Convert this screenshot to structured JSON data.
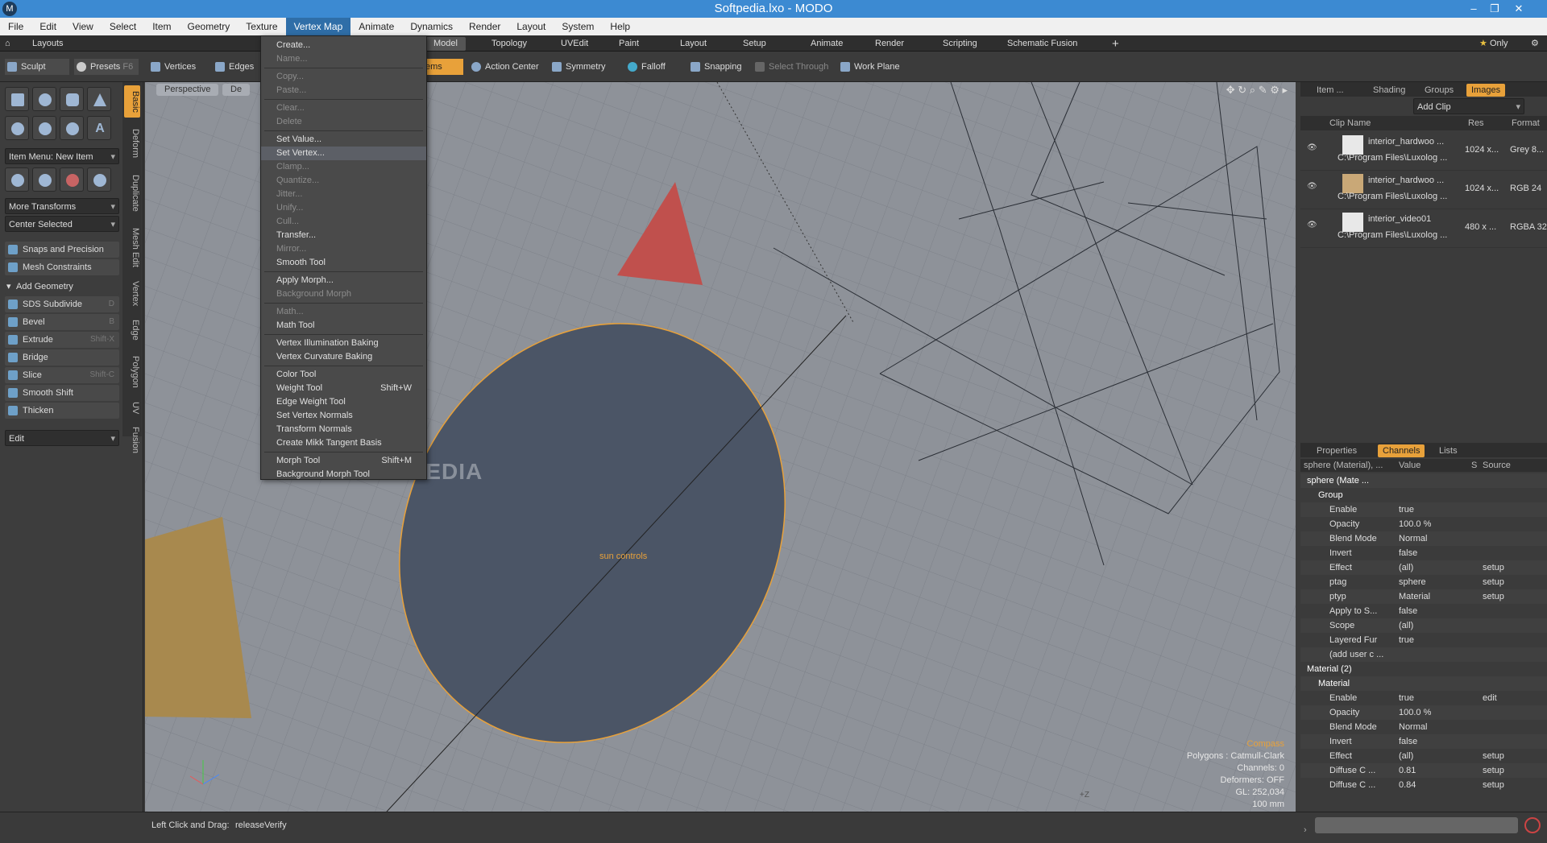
{
  "window": {
    "title": "Softpedia.lxo - MODO",
    "logo": "M"
  },
  "menubar": [
    "File",
    "Edit",
    "View",
    "Select",
    "Item",
    "Geometry",
    "Texture",
    "Vertex Map",
    "Animate",
    "Dynamics",
    "Render",
    "Layout",
    "System",
    "Help"
  ],
  "layouts_label": "Layouts",
  "tabs": [
    "Model",
    "Topology",
    "UVEdit",
    "Paint",
    "Layout",
    "Setup",
    "Animate",
    "Render",
    "Scripting",
    "Schematic Fusion"
  ],
  "only_label": "Only",
  "toolbar": {
    "sculpt": "Sculpt",
    "presets": "Presets",
    "presets_key": "F6",
    "vertices": "Vertices",
    "edges": "Edges",
    "items": "ems",
    "action_center": "Action Center",
    "symmetry": "Symmetry",
    "falloff": "Falloff",
    "snapping": "Snapping",
    "select_through": "Select Through",
    "work_plane": "Work Plane"
  },
  "left": {
    "item_menu": "Item Menu: New Item",
    "more_transforms": "More Transforms",
    "center_selected": "Center Selected",
    "snaps": "Snaps and Precision",
    "mesh_constraints": "Mesh Constraints",
    "add_geometry": "Add Geometry",
    "tools": [
      {
        "label": "SDS Subdivide",
        "key": "D"
      },
      {
        "label": "Bevel",
        "key": "B"
      },
      {
        "label": "Extrude",
        "key": "Shift-X"
      },
      {
        "label": "Bridge",
        "key": ""
      },
      {
        "label": "Slice",
        "key": "Shift-C"
      },
      {
        "label": "Smooth Shift",
        "key": ""
      },
      {
        "label": "Thicken",
        "key": ""
      }
    ],
    "edit_dropdown": "Edit",
    "vtabs": [
      "Basic",
      "Deform",
      "Duplicate",
      "Mesh Edit",
      "Vertex",
      "Edge",
      "Polygon",
      "UV",
      "Fusion"
    ]
  },
  "viewport": {
    "perspective": "Perspective",
    "de": "De",
    "center_label": "sun controls",
    "watermark": "SOFTPEDIA",
    "axis_label": "+Z",
    "info": [
      "Compass",
      "Polygons : Catmull-Clark",
      "Channels: 0",
      "Deformers: OFF",
      "GL: 252,034",
      "100 mm"
    ]
  },
  "menu": {
    "items": [
      {
        "label": "Create...",
        "dis": false
      },
      {
        "label": "Name...",
        "dis": true
      },
      {
        "sep": true
      },
      {
        "label": "Copy...",
        "dis": true
      },
      {
        "label": "Paste...",
        "dis": true
      },
      {
        "sep": true
      },
      {
        "label": "Clear...",
        "dis": true
      },
      {
        "label": "Delete",
        "dis": true
      },
      {
        "sep": true
      },
      {
        "label": "Set Value...",
        "dis": false
      },
      {
        "label": "Set Vertex...",
        "dis": false,
        "hl": true
      },
      {
        "label": "Clamp...",
        "dis": true
      },
      {
        "label": "Quantize...",
        "dis": true
      },
      {
        "label": "Jitter...",
        "dis": true
      },
      {
        "label": "Unify...",
        "dis": true
      },
      {
        "label": "Cull...",
        "dis": true
      },
      {
        "label": "Transfer...",
        "dis": false
      },
      {
        "label": "Mirror...",
        "dis": true
      },
      {
        "label": "Smooth Tool",
        "dis": false
      },
      {
        "sep": true
      },
      {
        "label": "Apply Morph...",
        "dis": false
      },
      {
        "label": "Background Morph",
        "dis": true
      },
      {
        "sep": true
      },
      {
        "label": "Math...",
        "dis": true
      },
      {
        "label": "Math Tool",
        "dis": false
      },
      {
        "sep": true
      },
      {
        "label": "Vertex Illumination Baking",
        "dis": false
      },
      {
        "label": "Vertex Curvature Baking",
        "dis": false
      },
      {
        "sep": true
      },
      {
        "label": "Color Tool",
        "dis": false
      },
      {
        "label": "Weight Tool",
        "key": "Shift+W",
        "dis": false
      },
      {
        "label": "Edge Weight Tool",
        "dis": false
      },
      {
        "label": "Set Vertex Normals",
        "dis": false
      },
      {
        "label": "Transform Normals",
        "dis": false
      },
      {
        "label": "Create Mikk Tangent Basis",
        "dis": false
      },
      {
        "sep": true
      },
      {
        "label": "Morph Tool",
        "key": "Shift+M",
        "dis": false
      },
      {
        "label": "Background Morph Tool",
        "dis": false
      }
    ]
  },
  "right": {
    "tabs_top": [
      "Item ...",
      "Shading",
      "Groups",
      "Images"
    ],
    "add_clip": "Add Clip",
    "headers": [
      "Clip Name",
      "Res",
      "Format"
    ],
    "clips": [
      {
        "name": "interior_hardwoo ...",
        "path": "C:\\Program Files\\Luxolog ...",
        "res": "1024 x...",
        "fmt": "Grey 8..."
      },
      {
        "name": "interior_hardwoo ...",
        "path": "C:\\Program Files\\Luxolog ...",
        "res": "1024 x...",
        "fmt": "RGB 24"
      },
      {
        "name": "interior_video01",
        "path": "C:\\Program Files\\Luxolog ...",
        "res": "480 x ...",
        "fmt": "RGBA 32"
      }
    ],
    "tabs_bottom": [
      "Properties",
      "Channels",
      "Lists"
    ],
    "ch_headers": [
      "sphere (Material), ...",
      "Value",
      "S",
      "Source"
    ],
    "channels": [
      {
        "n": "sphere (Mate ...",
        "v": "",
        "s": "",
        "ind": 0
      },
      {
        "n": "Group",
        "v": "",
        "s": "",
        "ind": 1
      },
      {
        "n": "Enable",
        "v": "true",
        "s": "",
        "ind": 2
      },
      {
        "n": "Opacity",
        "v": "100.0 %",
        "s": "",
        "ind": 2
      },
      {
        "n": "Blend Mode",
        "v": "Normal",
        "s": "",
        "ind": 2
      },
      {
        "n": "Invert",
        "v": "false",
        "s": "",
        "ind": 2
      },
      {
        "n": "Effect",
        "v": "(all)",
        "s": "setup",
        "ind": 2
      },
      {
        "n": "ptag",
        "v": "sphere",
        "s": "setup",
        "ind": 2
      },
      {
        "n": "ptyp",
        "v": "Material",
        "s": "setup",
        "ind": 2
      },
      {
        "n": "Apply to S...",
        "v": "false",
        "s": "",
        "ind": 2
      },
      {
        "n": "Scope",
        "v": "(all)",
        "s": "",
        "ind": 2
      },
      {
        "n": "Layered Fur",
        "v": "true",
        "s": "",
        "ind": 2
      },
      {
        "n": "(add user c ...",
        "v": "",
        "s": "",
        "ind": 2
      },
      {
        "n": "Material (2)",
        "v": "",
        "s": "",
        "ind": 0
      },
      {
        "n": "Material",
        "v": "",
        "s": "",
        "ind": 1
      },
      {
        "n": "Enable",
        "v": "true",
        "s": "edit",
        "ind": 2
      },
      {
        "n": "Opacity",
        "v": "100.0 %",
        "s": "",
        "ind": 2
      },
      {
        "n": "Blend Mode",
        "v": "Normal",
        "s": "",
        "ind": 2
      },
      {
        "n": "Invert",
        "v": "false",
        "s": "",
        "ind": 2
      },
      {
        "n": "Effect",
        "v": "(all)",
        "s": "setup",
        "ind": 2
      },
      {
        "n": "Diffuse C ...",
        "v": "0.81",
        "s": "setup",
        "ind": 2
      },
      {
        "n": "Diffuse C ...",
        "v": "0.84",
        "s": "setup",
        "ind": 2
      }
    ]
  },
  "status": {
    "left": "Left Click and Drag:",
    "right": "releaseVerify"
  }
}
